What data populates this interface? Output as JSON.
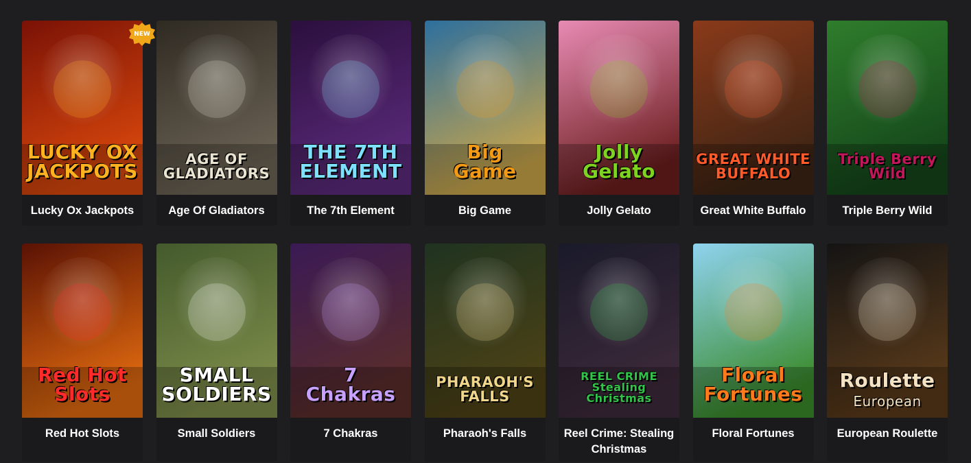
{
  "badge": {
    "new_label": "NEW"
  },
  "games": [
    {
      "title": "Lucky Ox Jackpots",
      "logo1": "LUCKY OX",
      "logo2": "JACKPOTS",
      "colors": [
        "#7a1206",
        "#d8470c"
      ],
      "logo_color": "#ffb21f",
      "icon": "ox-icon"
    },
    {
      "title": "Age Of Gladiators",
      "logo1": "AGE OF",
      "logo2": "GLADIATORS",
      "colors": [
        "#2f2a22",
        "#6b6355"
      ],
      "logo_color": "#e9e3d2",
      "icon": "helmet-icon"
    },
    {
      "title": "The 7th Element",
      "logo1": "THE 7TH",
      "logo2": "ELEMENT",
      "colors": [
        "#2b0f3d",
        "#5a2a7a"
      ],
      "logo_color": "#7ee0ff",
      "icon": "yin-yang-icon"
    },
    {
      "title": "Big Game",
      "logo1": "Big",
      "logo2": "Game",
      "colors": [
        "#2d6f9e",
        "#c9a54a"
      ],
      "logo_color": "#f29a16",
      "icon": "lion-icon"
    },
    {
      "title": "Jolly Gelato",
      "logo1": "Jolly",
      "logo2": "Gelato",
      "colors": [
        "#e88bb4",
        "#6b1e1e"
      ],
      "logo_color": "#7ed321",
      "icon": "ice-cream-icon"
    },
    {
      "title": "Great White Buffalo",
      "logo1": "GREAT WHITE",
      "logo2": "BUFFALO",
      "colors": [
        "#8a3a1a",
        "#3d2414"
      ],
      "logo_color": "#ff5a2a",
      "icon": "buffalo-icon"
    },
    {
      "title": "Triple Berry Wild",
      "logo1": "Triple Berry",
      "logo2": "Wild",
      "colors": [
        "#2f7d2c",
        "#14451a"
      ],
      "logo_color": "#c2185b",
      "icon": "berry-icon"
    },
    {
      "title": "Red Hot Slots",
      "logo1": "Red Hot",
      "logo2": "Slots",
      "colors": [
        "#5a1204",
        "#e06a10"
      ],
      "logo_color": "#ff2a2a",
      "icon": "bell-icon"
    },
    {
      "title": "Small Soldiers",
      "logo1": "SMALL",
      "logo2": "SOLDIERS",
      "colors": [
        "#445a2c",
        "#7d8c4a"
      ],
      "logo_color": "#ffffff",
      "icon": "soldier-icon"
    },
    {
      "title": "7 Chakras",
      "logo1": "7",
      "logo2": "Chakras",
      "colors": [
        "#3a1a55",
        "#5a2d2a"
      ],
      "logo_color": "#c8a0ff",
      "icon": "meditation-icon"
    },
    {
      "title": "Pharaoh's Falls",
      "logo1": "PHARAOH'S",
      "logo2": "FALLS",
      "colors": [
        "#1f3320",
        "#4d4216"
      ],
      "logo_color": "#f0d68a",
      "icon": "scarab-icon"
    },
    {
      "title": "Reel Crime: Stealing Christmas",
      "logo1": "REEL CRIME",
      "logo2": "Stealing Christmas",
      "colors": [
        "#1a1a2a",
        "#3d2a3a"
      ],
      "logo_color": "#33c24a",
      "icon": "robber-icon"
    },
    {
      "title": "Floral Fortunes",
      "logo1": "Floral",
      "logo2": "Fortunes",
      "colors": [
        "#8fd3f0",
        "#3a8a2a"
      ],
      "logo_color": "#ff7a1a",
      "icon": "flower-icon"
    },
    {
      "title": "European Roulette",
      "logo1": "Roulette",
      "logo2": "European",
      "colors": [
        "#141414",
        "#5a3a1a"
      ],
      "logo_color": "#f3e3c4",
      "icon": "roulette-icon"
    }
  ]
}
